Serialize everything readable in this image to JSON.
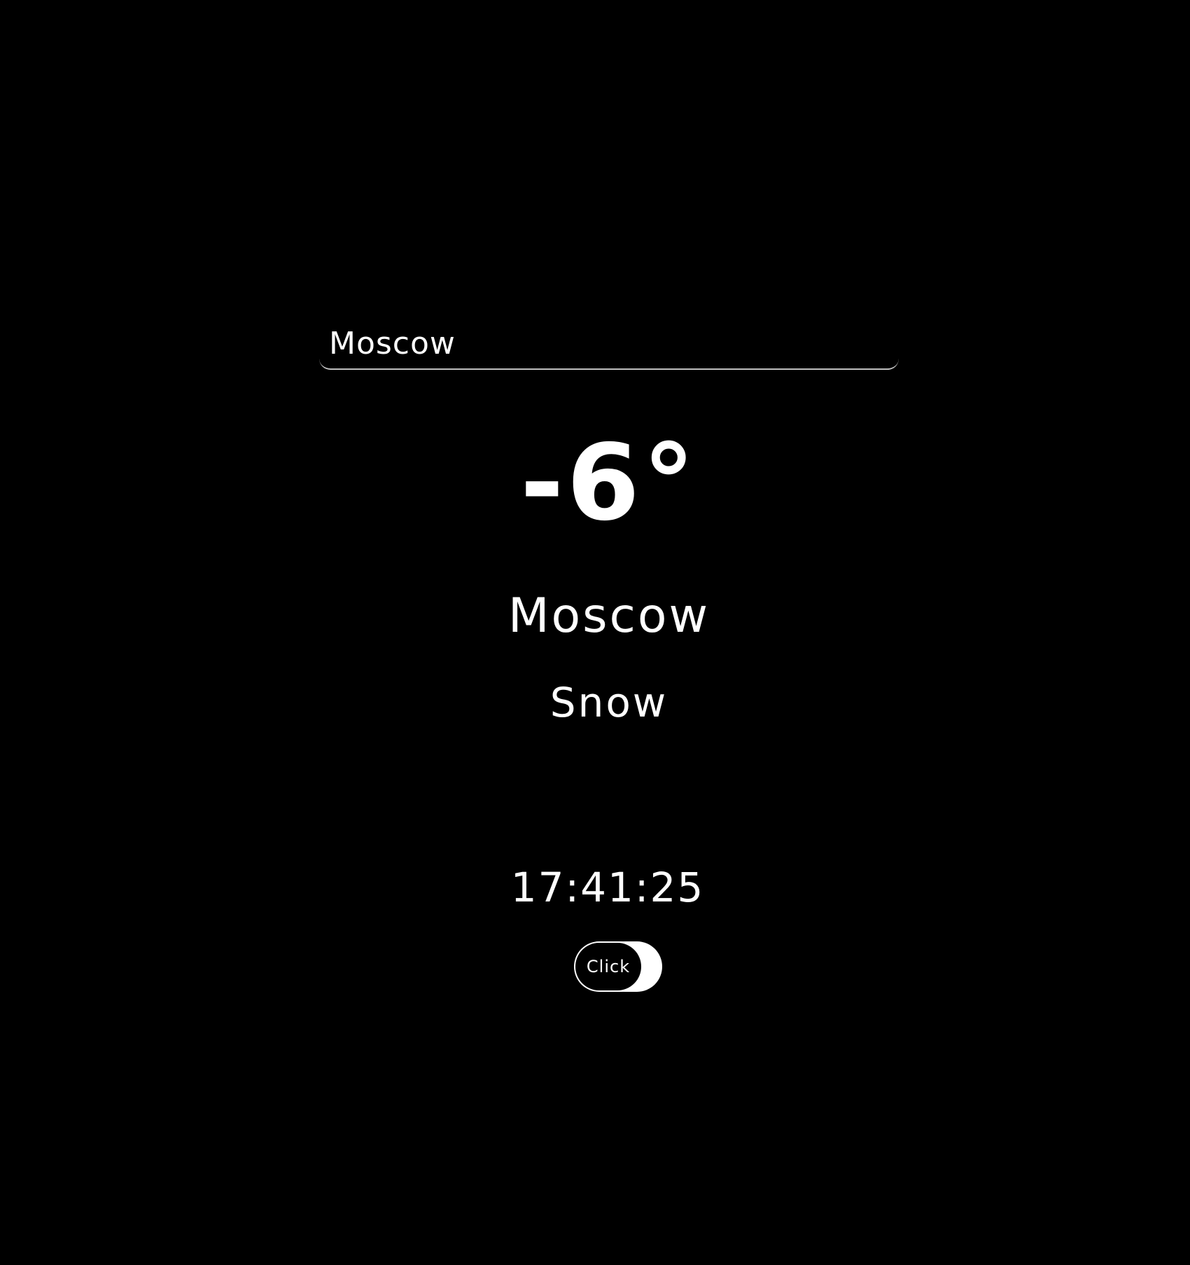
{
  "search": {
    "value": "Moscow"
  },
  "weather": {
    "temperature": "-6°",
    "city": "Moscow",
    "condition": "Snow"
  },
  "clock": {
    "time": "17:41:25"
  },
  "toggle": {
    "label": "Click",
    "state": "on"
  },
  "colors": {
    "background": "#000000",
    "text": "#ffffff",
    "underline": "#bfbfbf"
  }
}
